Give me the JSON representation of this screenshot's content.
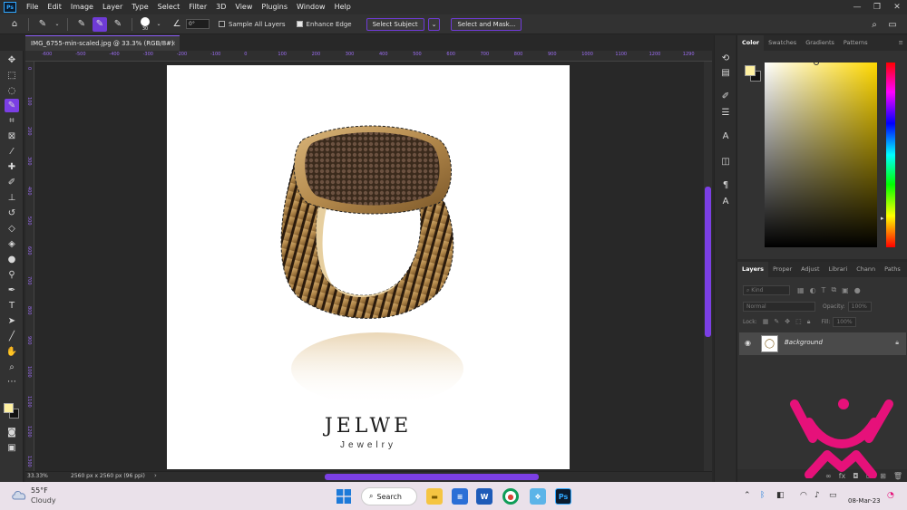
{
  "menubar": {
    "items": [
      "File",
      "Edit",
      "Image",
      "Layer",
      "Type",
      "Select",
      "Filter",
      "3D",
      "View",
      "Plugins",
      "Window",
      "Help"
    ],
    "app_logo": "Ps"
  },
  "options": {
    "brush_size": "30",
    "angle": "0°",
    "sample_all_layers": "Sample All Layers",
    "enhance_edge": "Enhance Edge",
    "select_subject": "Select Subject",
    "select_and_mask": "Select and Mask..."
  },
  "document": {
    "tab_title": "IMG_6755-min-scaled.jpg @ 33.3% (RGB/8#)",
    "close_glyph": "×",
    "zoom": "33.33%",
    "info": "2560 px x 2560 px (96 ppi)",
    "nav_arrow": "›"
  },
  "ruler": {
    "top_labels": [
      "-600",
      "-500",
      "-400",
      "-300",
      "-200",
      "-100",
      "0",
      "100",
      "200",
      "300",
      "400",
      "500",
      "600",
      "700",
      "800",
      "900",
      "1000",
      "1100",
      "1200",
      "1290"
    ],
    "left_labels": [
      "0",
      "100",
      "200",
      "300",
      "400",
      "500",
      "600",
      "700",
      "800",
      "900",
      "1000",
      "1100",
      "1200",
      "1300"
    ]
  },
  "canvas": {
    "brand_name": "JELWE",
    "brand_sub": "Jewelry"
  },
  "color_panel": {
    "tabs": [
      "Color",
      "Swatches",
      "Gradients",
      "Patterns"
    ],
    "foreground": "#fff1a1",
    "background": "#111111"
  },
  "layers_panel": {
    "tabs": [
      "Layers",
      "Proper",
      "Adjust",
      "Librari",
      "Chann",
      "Paths"
    ],
    "kind_placeholder": "Kind",
    "blend_mode": "Normal",
    "opacity_label": "Opacity:",
    "opacity_value": "100%",
    "lock_label": "Lock:",
    "fill_label": "Fill:",
    "fill_value": "100%",
    "layer_name": "Background"
  },
  "taskbar": {
    "temperature": "55°F",
    "weather": "Cloudy",
    "search_label": "Search",
    "date": "08-Mar-23"
  },
  "colors": {
    "accent": "#7b3fe4",
    "watermark": "#e6117a"
  }
}
